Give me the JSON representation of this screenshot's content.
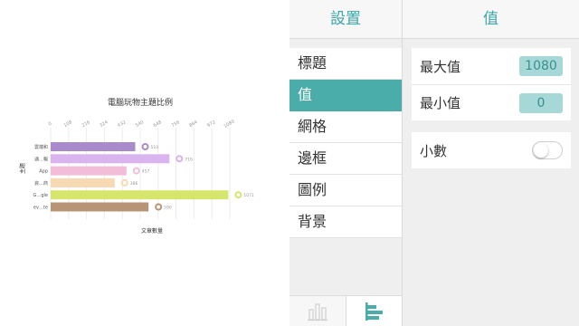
{
  "chart_data": {
    "type": "bar",
    "orientation": "horizontal",
    "title": "電腦玩物主題比例",
    "xlabel": "文章數量",
    "ylabel": "主題",
    "xlim": [
      0,
      1080
    ],
    "x_ticks": [
      "0",
      "108",
      "216",
      "324",
      "432",
      "540",
      "648",
      "756",
      "864",
      "972",
      "1080"
    ],
    "categories": [
      "雲端和",
      "通…報",
      "App",
      "資…商",
      "G…gle",
      "ev…te"
    ],
    "values": [
      510,
      716,
      457,
      386,
      1071,
      590
    ],
    "value_labels": [
      "510",
      "716",
      "457",
      "386",
      "1071",
      "590"
    ],
    "colors": [
      "#a98bcb",
      "#d9b4ef",
      "#f2bdd8",
      "#f7d9b3",
      "#d6e56c",
      "#b89477"
    ],
    "grid": true,
    "legend": "none"
  },
  "settings": {
    "header": "設置",
    "items": [
      {
        "label": "標題"
      },
      {
        "label": "值"
      },
      {
        "label": "網格"
      },
      {
        "label": "邊框"
      },
      {
        "label": "圖例"
      },
      {
        "label": "背景"
      }
    ],
    "selected_index": 1,
    "tabs": [
      {
        "icon": "vertical-bar-chart-icon",
        "active": false
      },
      {
        "icon": "horizontal-bar-chart-icon",
        "active": true
      }
    ]
  },
  "values_panel": {
    "header": "值",
    "max_label": "最大值",
    "max_value": "1080",
    "min_label": "最小值",
    "min_value": "0",
    "decimal_label": "小數",
    "decimal_enabled": false
  },
  "colors": {
    "accent": "#4aadaa",
    "header_text": "#3aa7a8",
    "value_box": "#a6d8d8"
  }
}
